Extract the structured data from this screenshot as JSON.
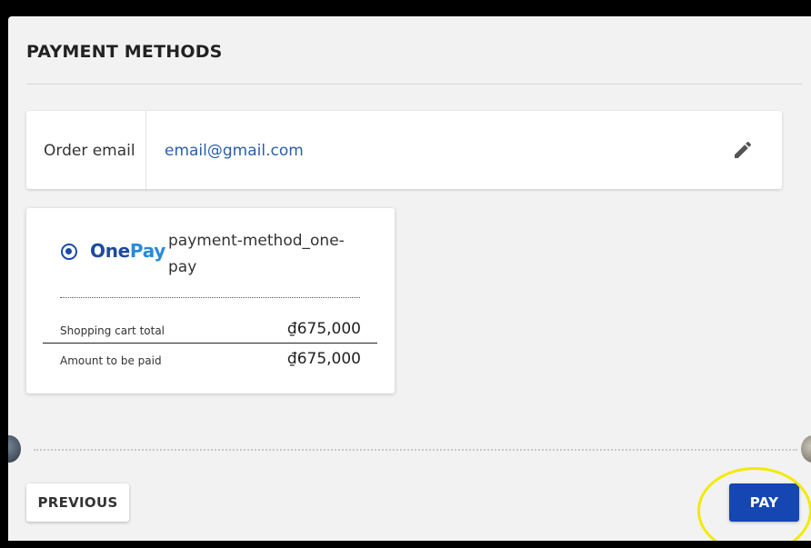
{
  "page": {
    "title": "PAYMENT METHODS"
  },
  "order_email": {
    "label": "Order email",
    "value": "email@gmail.com",
    "edit_icon": "pencil-icon"
  },
  "payment_method": {
    "logo_part1": "One",
    "logo_part2": "Pay",
    "name": "payment-method_one-pay",
    "selected": true,
    "shopping_cart_total_label": "Shopping cart total",
    "shopping_cart_total_value": "₫675,000",
    "amount_to_be_paid_label": "Amount to be paid",
    "amount_to_be_paid_value": "₫675,000"
  },
  "actions": {
    "previous_label": "PREVIOUS",
    "pay_label": "PAY"
  },
  "colors": {
    "accent": "#1546b2",
    "link": "#2b5ea8",
    "highlight": "#f2ea00"
  }
}
